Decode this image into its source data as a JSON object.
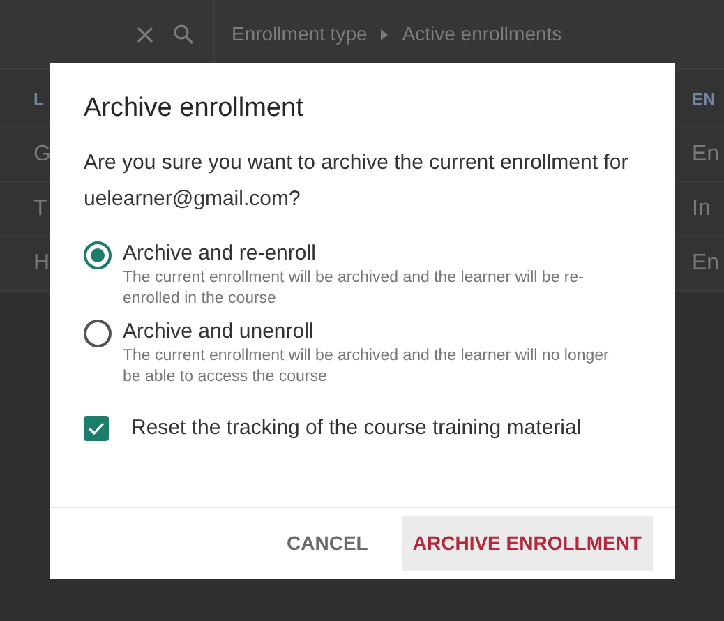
{
  "toolbar": {
    "breadcrumb": [
      "Enrollment type",
      "Active enrollments"
    ]
  },
  "table": {
    "columns": [
      "L",
      "EN"
    ],
    "rows": [
      [
        "G",
        "En"
      ],
      [
        "T",
        "In"
      ],
      [
        "H",
        "En"
      ]
    ]
  },
  "dialog": {
    "title": "Archive enrollment",
    "message": "Are you sure you want to archive the current enrollment for uelearner@gmail.com?",
    "options": [
      {
        "label": "Archive and re-enroll",
        "description": "The current enrollment will be archived and the learner will be re-enrolled in the course",
        "selected": true
      },
      {
        "label": "Archive and unenroll",
        "description": "The current enrollment will be archived and the learner will no longer be able to access the course",
        "selected": false
      }
    ],
    "checkbox": {
      "label": "Reset the tracking of the course training material",
      "checked": true
    },
    "buttons": [
      {
        "label": "CANCEL",
        "kind": "text"
      },
      {
        "label": "ARCHIVE ENROLLMENT",
        "kind": "primary"
      }
    ]
  }
}
